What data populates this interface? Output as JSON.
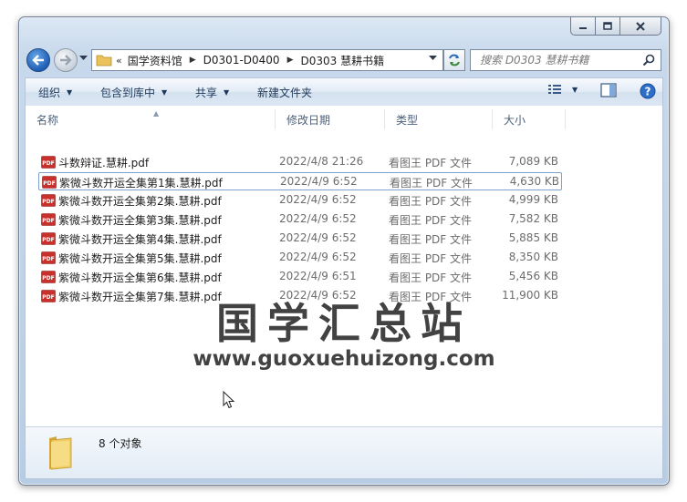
{
  "navigation": {
    "address": {
      "overflow": "«",
      "crumbs": [
        "国学资料馆",
        "D0301-D0400",
        "D0303 慧耕书籍"
      ]
    },
    "search": {
      "placeholder": "搜索 D0303 慧耕书籍"
    }
  },
  "toolbar": {
    "organize": "组织",
    "include_in_library": "包含到库中",
    "share": "共享",
    "new_folder": "新建文件夹"
  },
  "columns": {
    "name": "名称",
    "date": "修改日期",
    "type": "类型",
    "size": "大小"
  },
  "files": [
    {
      "name": "斗数辩证.慧耕.pdf",
      "date": "2022/4/8 21:26",
      "type": "看图王 PDF 文件",
      "size": "7,089 KB"
    },
    {
      "name": "紫微斗数开运全集第1集.慧耕.pdf",
      "date": "2022/4/9 6:52",
      "type": "看图王 PDF 文件",
      "size": "4,630 KB"
    },
    {
      "name": "紫微斗数开运全集第2集.慧耕.pdf",
      "date": "2022/4/9 6:52",
      "type": "看图王 PDF 文件",
      "size": "4,999 KB"
    },
    {
      "name": "紫微斗数开运全集第3集.慧耕.pdf",
      "date": "2022/4/9 6:52",
      "type": "看图王 PDF 文件",
      "size": "7,582 KB"
    },
    {
      "name": "紫微斗数开运全集第4集.慧耕.pdf",
      "date": "2022/4/9 6:52",
      "type": "看图王 PDF 文件",
      "size": "5,885 KB"
    },
    {
      "name": "紫微斗数开运全集第5集.慧耕.pdf",
      "date": "2022/4/9 6:52",
      "type": "看图王 PDF 文件",
      "size": "8,350 KB"
    },
    {
      "name": "紫微斗数开运全集第6集.慧耕.pdf",
      "date": "2022/4/9 6:51",
      "type": "看图王 PDF 文件",
      "size": "5,456 KB"
    },
    {
      "name": "紫微斗数开运全集第7集.慧耕.pdf",
      "date": "2022/4/9 6:52",
      "type": "看图王 PDF 文件",
      "size": "11,900 KB"
    }
  ],
  "focused_row_index": 1,
  "watermark": {
    "title": "国学汇总站",
    "url": "www.guoxuehuizong.com"
  },
  "details": {
    "count": "8 个对象"
  },
  "icons": {
    "back": "back-arrow-icon",
    "forward": "forward-arrow-icon",
    "refresh": "refresh-icon",
    "search": "search-icon",
    "views": "view-options-icon",
    "preview": "preview-pane-icon",
    "help": "help-icon",
    "file": "pdf-file-icon",
    "folder": "folder-icon"
  },
  "colors": {
    "accent": "#1f5fb4",
    "toolbar_text": "#1e395b",
    "pdf_red": "#c8302b",
    "help_blue": "#2c6fc9"
  }
}
